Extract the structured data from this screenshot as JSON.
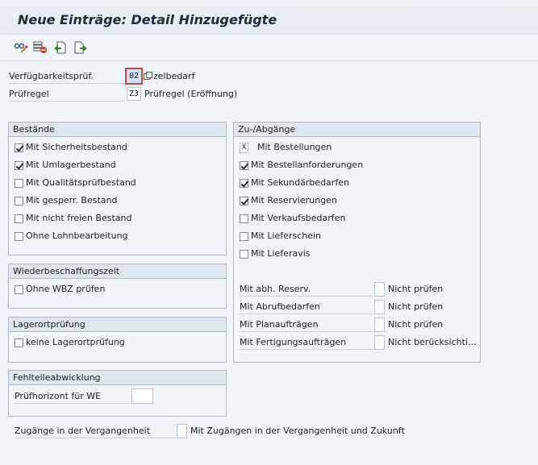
{
  "title": "Neue Einträge: Detail Hinzugefügte",
  "toolbar": {
    "icons": [
      "glasses-edit-icon",
      "delete-row-icon",
      "previous-entry-icon",
      "next-entry-icon"
    ]
  },
  "header_fields": {
    "verfuegbarkeit": {
      "label": "Verfügbarkeitsprüf.",
      "value": "02",
      "desc": "Einzelbedarf"
    },
    "pruefregel": {
      "label": "Prüfregel",
      "value": "Z3",
      "desc": "Prüfregel (Eröffnung)"
    }
  },
  "bestaende": {
    "title": "Bestände",
    "items": [
      {
        "label": "Mit Sicherheitsbestand",
        "checked": true
      },
      {
        "label": "Mit Umlagerbestand",
        "checked": true
      },
      {
        "label": "Mit Qualitätsprüfbestand",
        "checked": false
      },
      {
        "label": "Mit gesperr. Bestand",
        "checked": false
      },
      {
        "label": "Mit nicht freien Bestand",
        "checked": false
      },
      {
        "label": "Ohne Lohnbearbeitung",
        "checked": false
      }
    ]
  },
  "wbz": {
    "title": "Wiederbeschaffungszeit",
    "item": {
      "label": "Ohne WBZ prüfen",
      "checked": false
    }
  },
  "lagerort": {
    "title": "Lagerortprüfung",
    "item": {
      "label": "keine Lagerortprüfung",
      "checked": false
    }
  },
  "fehlteile": {
    "title": "Fehlteileabwicklung",
    "label": "Prüfhorizont für WE",
    "value": ""
  },
  "zugaenge": {
    "label": "Zugänge in der Vergangenheit",
    "desc": "Mit Zugängen in der Vergangenheit und Zukunft"
  },
  "zu_abgaenge": {
    "title": "Zu-/Abgänge",
    "bestellungen": {
      "label": "Mit Bestellungen",
      "mark": "X"
    },
    "items": [
      {
        "label": "Mit Bestellanforderungen",
        "checked": true
      },
      {
        "label": "Mit Sekundärbedarfen",
        "checked": true
      },
      {
        "label": "Mit Reservierungen",
        "checked": true
      },
      {
        "label": "Mit Verkaufsbedarfen",
        "checked": false
      },
      {
        "label": "Mit Lieferschein",
        "checked": false
      },
      {
        "label": "Mit Lieferavis",
        "checked": false
      }
    ],
    "rows": [
      {
        "label": "Mit abh. Reserv.",
        "value": "Nicht prüfen"
      },
      {
        "label": "Mit Abrufbedarfen",
        "value": "Nicht prüfen"
      },
      {
        "label": "Mit Planaufträgen",
        "value": "Nicht prüfen"
      },
      {
        "label": "Mit Fertigungsaufträgen",
        "value": "Nicht berücksichti..."
      }
    ]
  }
}
